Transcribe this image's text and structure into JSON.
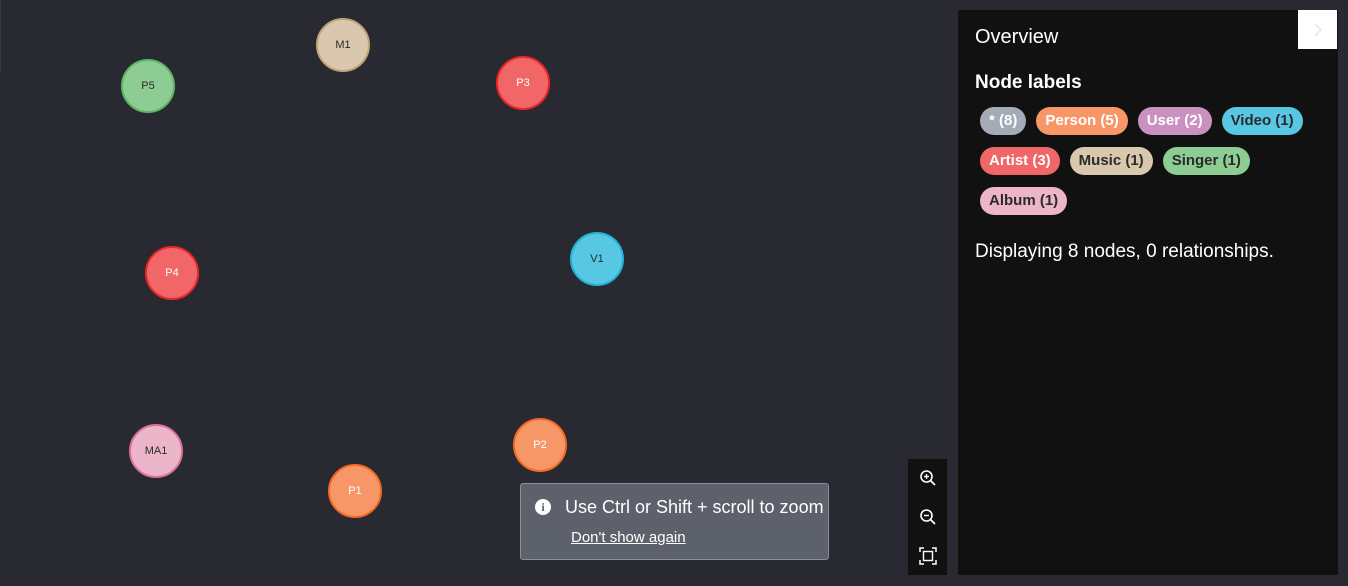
{
  "graph": {
    "nodes": [
      {
        "id": "P5",
        "label": "P5",
        "fill": "#8dcc93",
        "border": "#5db665",
        "text": "#2b2b2b"
      },
      {
        "id": "M1",
        "label": "M1",
        "fill": "#d9c8ae",
        "border": "#c0a378",
        "text": "#2b2b2b"
      },
      {
        "id": "P3",
        "label": "P3",
        "fill": "#f16667",
        "border": "#eb2728",
        "text": "#ffffff"
      },
      {
        "id": "P4",
        "label": "P4",
        "fill": "#f16667",
        "border": "#eb2728",
        "text": "#ffffff"
      },
      {
        "id": "V1",
        "label": "V1",
        "fill": "#57c7e3",
        "border": "#23b3d7",
        "text": "#2b2b2b"
      },
      {
        "id": "MA1",
        "label": "MA1",
        "fill": "#ecb5c9",
        "border": "#da7298",
        "text": "#2b2b2b"
      },
      {
        "id": "P1",
        "label": "P1",
        "fill": "#f79767",
        "border": "#f36924",
        "text": "#ffffff"
      },
      {
        "id": "P2",
        "label": "P2",
        "fill": "#f79767",
        "border": "#f36924",
        "text": "#ffffff"
      }
    ]
  },
  "zoom_controls": {
    "zoom_in_icon": "zoom-in-icon",
    "zoom_out_icon": "zoom-out-icon",
    "fit_icon": "fit-to-screen-icon"
  },
  "toast": {
    "icon": "info-icon",
    "icon_glyph": "i",
    "message": "Use Ctrl or Shift + scroll to zoom",
    "dismiss_label": "Don't show again"
  },
  "panel": {
    "title": "Overview",
    "collapse_icon": "chevron-right-icon",
    "labels_heading": "Node labels",
    "labels": [
      {
        "text": "* (8)",
        "bg": "#a5abb6",
        "color": "#ffffff"
      },
      {
        "text": "Person (5)",
        "bg": "#f79767",
        "color": "#ffffff"
      },
      {
        "text": "User (2)",
        "bg": "#c990c0",
        "color": "#ffffff"
      },
      {
        "text": "Video (1)",
        "bg": "#57c7e3",
        "color": "#2b2b2b"
      },
      {
        "text": "Artist (3)",
        "bg": "#f16667",
        "color": "#ffffff"
      },
      {
        "text": "Music (1)",
        "bg": "#d9c8ae",
        "color": "#2b2b2b"
      },
      {
        "text": "Singer (1)",
        "bg": "#8dcc93",
        "color": "#2b2b2b"
      },
      {
        "text": "Album (1)",
        "bg": "#ecb5c9",
        "color": "#2b2b2b"
      }
    ],
    "summary": "Displaying 8 nodes, 0 relationships."
  }
}
